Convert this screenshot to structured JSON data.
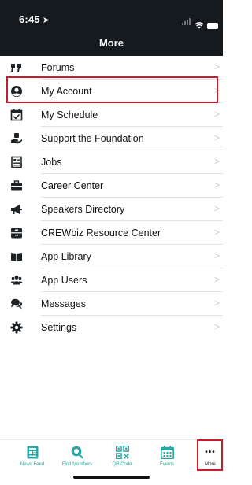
{
  "status_bar": {
    "time": "6:45",
    "location_icon": "location-arrow-icon",
    "signal_icon": "cellular-signal-icon",
    "wifi_icon": "wifi-icon",
    "battery_icon": "battery-icon"
  },
  "header": {
    "title": "More"
  },
  "menu": {
    "items": [
      {
        "label": "Forums",
        "icon": "quote-icon"
      },
      {
        "label": "My Account",
        "icon": "user-circle-icon"
      },
      {
        "label": "My Schedule",
        "icon": "calendar-check-icon"
      },
      {
        "label": "Support the Foundation",
        "icon": "donate-hand-icon"
      },
      {
        "label": "Jobs",
        "icon": "document-list-icon"
      },
      {
        "label": "Career Center",
        "icon": "briefcase-icon"
      },
      {
        "label": "Speakers Directory",
        "icon": "megaphone-icon"
      },
      {
        "label": "CREWbiz Resource Center",
        "icon": "archive-box-icon"
      },
      {
        "label": "App Library",
        "icon": "book-open-icon"
      },
      {
        "label": "App Users",
        "icon": "users-icon"
      },
      {
        "label": "Messages",
        "icon": "chat-bubbles-icon"
      },
      {
        "label": "Settings",
        "icon": "gear-icon"
      }
    ],
    "chevron": ">"
  },
  "tabbar": {
    "tabs": [
      {
        "label": "News Feed",
        "icon": "news-feed-icon"
      },
      {
        "label": "Find Members",
        "icon": "search-icon"
      },
      {
        "label": "QR Code",
        "icon": "qr-code-icon"
      },
      {
        "label": "Events",
        "icon": "calendar-icon"
      },
      {
        "label": "More",
        "icon": "ellipsis-icon"
      }
    ],
    "more_glyph": "•••"
  },
  "colors": {
    "header_bg": "#151a1f",
    "accent_teal": "#2aa6a3",
    "highlight_red": "#c91c2a"
  }
}
